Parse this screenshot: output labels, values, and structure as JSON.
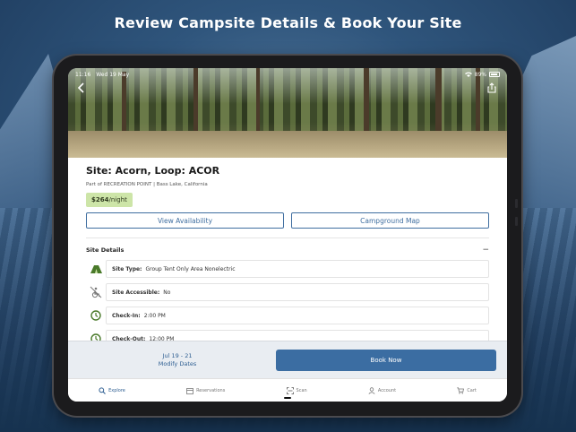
{
  "headline": "Review Campsite Details & Book Your Site",
  "status": {
    "time": "11:16",
    "date": "Wed 19 May",
    "battery": "89%"
  },
  "site": {
    "title": "Site: Acorn, Loop: ACOR",
    "subtitle": "Part of RECREATION POINT | Bass Lake, California",
    "price": "$264",
    "price_unit": "/night"
  },
  "buttons": {
    "view_availability": "View Availability",
    "campground_map": "Campground Map",
    "book_now": "Book Now"
  },
  "details": {
    "header": "Site Details",
    "collapse_icon": "minus",
    "rows": [
      {
        "icon": "tent-icon",
        "label": "Site Type:",
        "value": "Group Tent Only Area Nonelectric"
      },
      {
        "icon": "not-accessible-icon",
        "label": "Site Accessible:",
        "value": "No"
      },
      {
        "icon": "clock-icon",
        "label": "Check-In:",
        "value": "2:00 PM"
      },
      {
        "icon": "clock-icon",
        "label": "Check-Out:",
        "value": "12:00 PM"
      }
    ]
  },
  "dates": {
    "range": "Jul 19 - 21",
    "modify": "Modify Dates"
  },
  "tabs": [
    {
      "label": "Explore",
      "icon": "search-icon",
      "active": true
    },
    {
      "label": "Reservations",
      "icon": "calendar-icon",
      "active": false
    },
    {
      "label": "Scan",
      "icon": "scan-icon",
      "active": false
    },
    {
      "label": "Account",
      "icon": "account-icon",
      "active": false
    },
    {
      "label": "Cart",
      "icon": "cart-icon",
      "active": false
    }
  ],
  "colors": {
    "accent": "#3b6da2",
    "green_icon": "#4a7a2a",
    "price_badge": "#cde5a8"
  }
}
